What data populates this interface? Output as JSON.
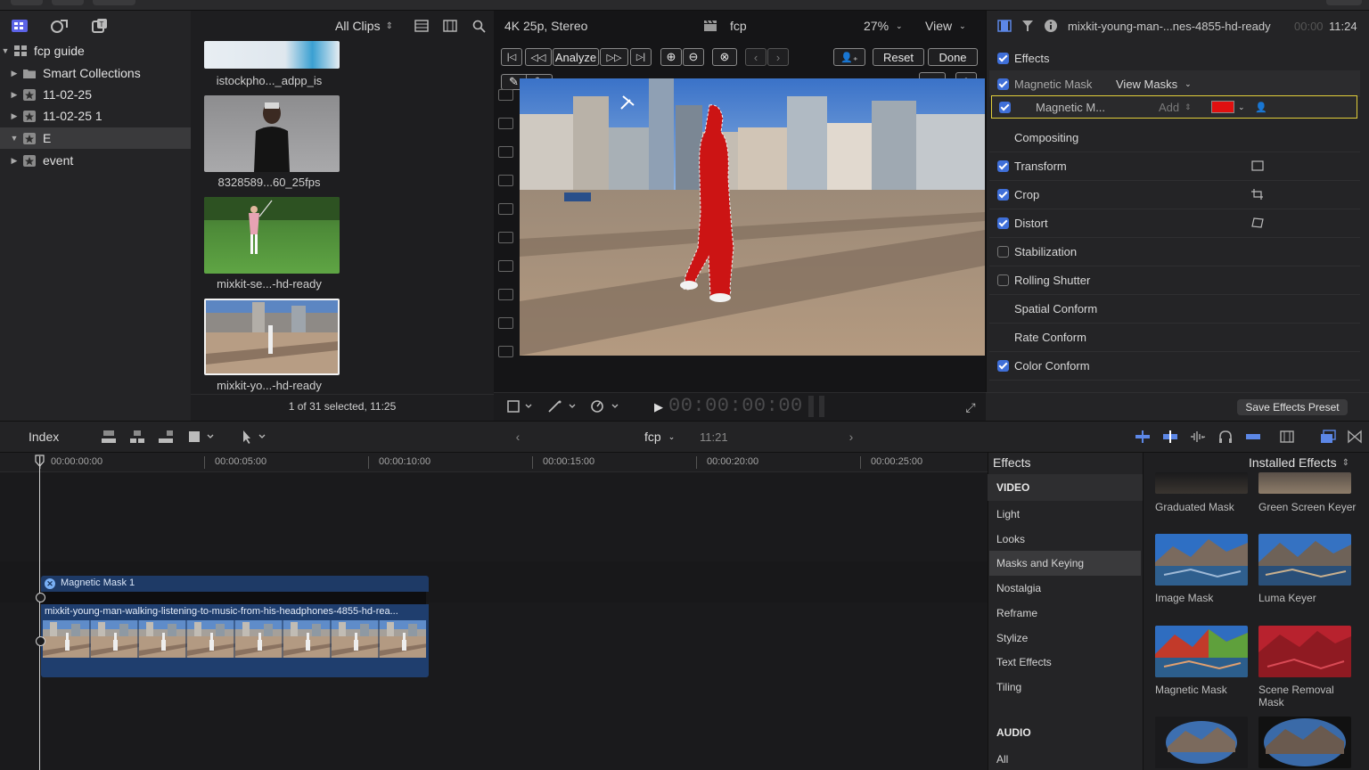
{
  "library": {
    "items": [
      {
        "label": "fcp guide",
        "expanded": true,
        "icon": "library-icon"
      },
      {
        "label": "Smart Collections",
        "expanded": false,
        "icon": "folder-icon"
      },
      {
        "label": "11-02-25",
        "expanded": false,
        "icon": "event-icon"
      },
      {
        "label": "11-02-25 1",
        "expanded": false,
        "icon": "event-icon"
      },
      {
        "label": "E",
        "expanded": true,
        "icon": "event-icon",
        "selected": true
      },
      {
        "label": "event",
        "expanded": false,
        "icon": "event-icon"
      }
    ]
  },
  "browser": {
    "filter": "All Clips",
    "clips": [
      {
        "label": "istockpho..._adpp_is"
      },
      {
        "label": "8328589...60_25fps"
      },
      {
        "label": "mixkit-se...-hd-ready"
      },
      {
        "label": "mixkit-yo...-hd-ready",
        "selected": true
      }
    ],
    "status": "1 of 31 selected, 11:25"
  },
  "viewer": {
    "format": "4K 25p, Stereo",
    "project": "fcp",
    "zoom": "27%",
    "view_menu": "View",
    "analyze_label": "Analyze",
    "reset_label": "Reset",
    "done_label": "Done",
    "timecode": "00:00:00:00"
  },
  "inspector": {
    "clip_name": "mixkit-young-man-...nes-4855-hd-ready",
    "duration": "11:24",
    "duration_prefix": "00:00",
    "effects_label": "Effects",
    "magnetic_mask_label": "Magnetic Mask",
    "view_masks_label": "View Masks",
    "mask_row_label": "Magnetic M...",
    "mask_mode": "Add",
    "mask_color": "#e01010",
    "rows": [
      {
        "label": "Compositing",
        "checkbox": "none"
      },
      {
        "label": "Transform",
        "checkbox": "on",
        "icon": "transform-icon"
      },
      {
        "label": "Crop",
        "checkbox": "on",
        "icon": "crop-icon"
      },
      {
        "label": "Distort",
        "checkbox": "on",
        "icon": "distort-icon"
      },
      {
        "label": "Stabilization",
        "checkbox": "off"
      },
      {
        "label": "Rolling Shutter",
        "checkbox": "off"
      },
      {
        "label": "Spatial Conform",
        "checkbox": "none"
      },
      {
        "label": "Rate Conform",
        "checkbox": "none"
      },
      {
        "label": "Color Conform",
        "checkbox": "on"
      }
    ],
    "save_preset_label": "Save Effects Preset"
  },
  "timeline": {
    "index_label": "Index",
    "project": "fcp",
    "duration": "11:21",
    "ticks": [
      "00:00:00:00",
      "00:00:05:00",
      "00:00:10:00",
      "00:00:15:00",
      "00:00:20:00",
      "00:00:25:00"
    ],
    "effect_bar_label": "Magnetic Mask 1",
    "clip_label": "mixkit-young-man-walking-listening-to-music-from-his-headphones-4855-hd-rea..."
  },
  "effects_browser": {
    "title": "Effects",
    "source": "Installed Effects",
    "video_header": "VIDEO",
    "categories": [
      "Light",
      "Looks",
      "Masks and Keying",
      "Nostalgia",
      "Reframe",
      "Stylize",
      "Text Effects",
      "Tiling"
    ],
    "selected_category": "Masks and Keying",
    "audio_header": "AUDIO",
    "audio_all": "All",
    "tiles": [
      {
        "name": "Graduated Mask"
      },
      {
        "name": "Green Screen Keyer"
      },
      {
        "name": "Image Mask"
      },
      {
        "name": "Luma Keyer"
      },
      {
        "name": "Magnetic Mask"
      },
      {
        "name": "Scene Removal Mask"
      }
    ]
  }
}
